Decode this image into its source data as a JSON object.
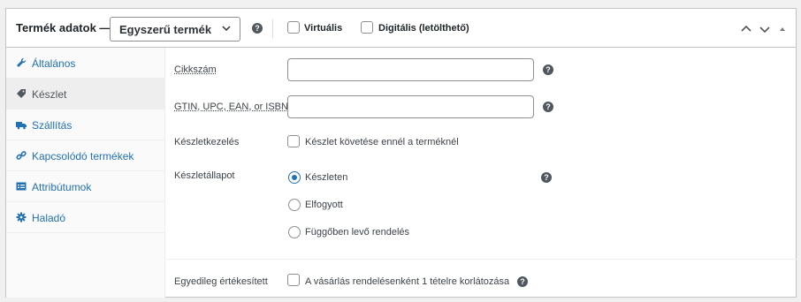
{
  "header": {
    "title": "Termék adatok —",
    "product_type_value": "Egyszerű termék",
    "virtual_label": "Virtuális",
    "downloadable_label": "Digitális (letölthető)",
    "help_glyph": "?"
  },
  "sidebar": {
    "items": [
      {
        "label": "Általános",
        "icon": "wrench-icon"
      },
      {
        "label": "Készlet",
        "icon": "inventory-tag-icon"
      },
      {
        "label": "Szállítás",
        "icon": "truck-icon"
      },
      {
        "label": "Kapcsolódó termékek",
        "icon": "link-icon"
      },
      {
        "label": "Attribútumok",
        "icon": "list-card-icon"
      },
      {
        "label": "Haladó",
        "icon": "gear-icon"
      }
    ],
    "active_index": 1
  },
  "inventory": {
    "sku_label": "Cikkszám",
    "sku_value": "",
    "gtin_label": "GTIN, UPC, EAN, or ISBN",
    "gtin_value": "",
    "manage_stock_label": "Készletkezelés",
    "manage_stock_checkbox_label": "Készlet követése ennél a terméknél",
    "stock_status_label": "Készletállapot",
    "stock_status_options": [
      "Készleten",
      "Elfogyott",
      "Függőben levő rendelés"
    ],
    "stock_status_selected": "Készleten",
    "sold_individually_label": "Egyedileg értékesített",
    "sold_individually_checkbox_label": "A vásárlás rendelésenként 1 tételre korlátozása"
  },
  "colors": {
    "link": "#2271b1",
    "border": "#c3c4c7",
    "background": "#f0f0f1"
  }
}
